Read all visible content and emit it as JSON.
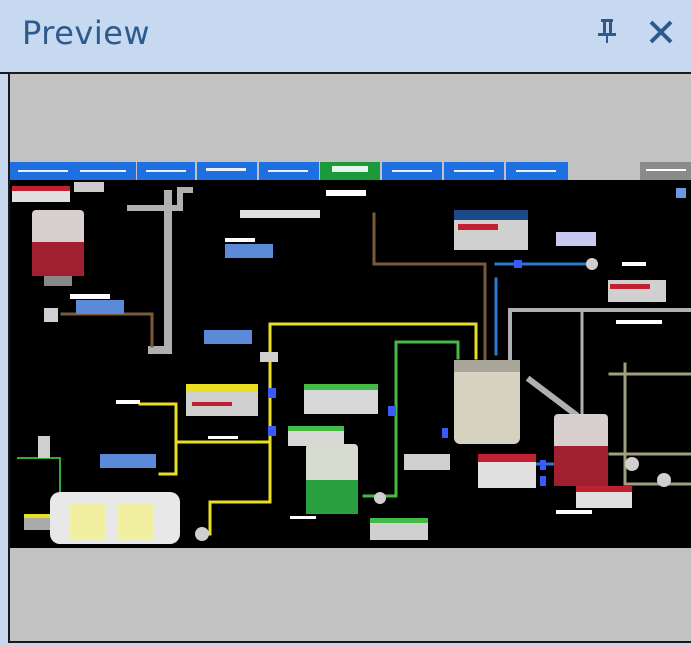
{
  "window": {
    "title": "Preview",
    "pin_glyph": "个",
    "close_glyph": "✕"
  },
  "preview": {
    "nav_buttons": [
      "",
      "",
      "",
      "",
      "",
      "",
      "",
      "",
      ""
    ],
    "colors": {
      "nav_blue": "#1e6fe0",
      "nav_green": "#1a9a3a",
      "canvas_bg": "#000000",
      "pipe_gray": "#b0b0b0",
      "pipe_yellow": "#e8e020",
      "pipe_green": "#44bb44",
      "pipe_brown": "#7a5a3a",
      "pipe_blue": "#2a7ad0",
      "pipe_olive": "#a0a080"
    }
  }
}
